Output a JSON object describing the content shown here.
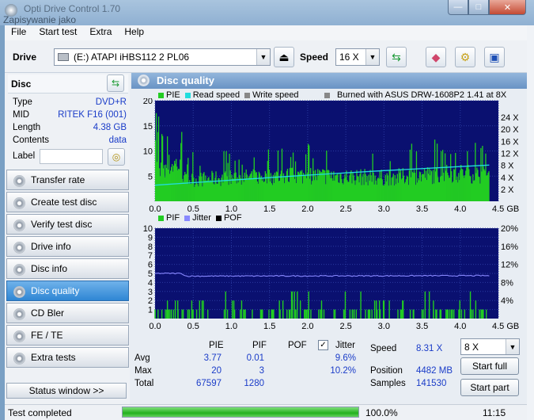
{
  "window": {
    "title": "Opti Drive Control 1.70",
    "subtitle": "Zapisywanie jako",
    "min": "—",
    "max": "□",
    "close": "✕"
  },
  "menu": [
    "File",
    "Start test",
    "Extra",
    "Help"
  ],
  "toolbar": {
    "drive_label": "Drive",
    "drive_value": "(E:)   ATAPI iHBS112   2 PL06",
    "speed_label": "Speed",
    "speed_value": "16 X"
  },
  "disc": {
    "header": "Disc",
    "rows": [
      {
        "k": "Type",
        "v": "DVD+R"
      },
      {
        "k": "MID",
        "v": "RITEK F16 (001)"
      },
      {
        "k": "Length",
        "v": "4.38 GB"
      },
      {
        "k": "Contents",
        "v": "data"
      }
    ],
    "label_key": "Label",
    "label_value": ""
  },
  "nav": [
    "Transfer rate",
    "Create test disc",
    "Verify test disc",
    "Drive info",
    "Disc info",
    "Disc quality",
    "CD Bler",
    "FE / TE",
    "Extra tests"
  ],
  "nav_active": 5,
  "status_window": "Status window >>",
  "panel": {
    "title": "Disc quality"
  },
  "legend_top": {
    "pie": "PIE",
    "read": "Read speed",
    "write": "Write speed",
    "burned": "Burned with ASUS DRW-1608P2 1.41 at 8X"
  },
  "legend_bottom": {
    "pif": "PIF",
    "jitter": "Jitter",
    "pof": "POF"
  },
  "colors": {
    "pie": "#22cc22",
    "read": "#22dddd",
    "write": "#888888",
    "pif": "#22cc22",
    "jitter": "#8888ff",
    "pof": "#000000",
    "plot_bg": "#0a1070",
    "accent": "#2f86d4"
  },
  "chart_data": [
    {
      "type": "bar",
      "x_ticks": [
        "0.0",
        "0.5",
        "1.0",
        "1.5",
        "2.0",
        "2.5",
        "3.0",
        "3.5",
        "4.0",
        "4.5 GB"
      ],
      "y_left_ticks": [
        "5",
        "10",
        "15",
        "20"
      ],
      "y_right_ticks": [
        "2 X",
        "4 X",
        "8 X",
        "12 X",
        "16 X",
        "20 X",
        "24 X"
      ],
      "xlim": [
        0,
        4.5
      ],
      "ylim": [
        0,
        20
      ],
      "series": [
        {
          "name": "PIE",
          "profile": [
            [
              0,
              14
            ],
            [
              0.3,
              16
            ],
            [
              0.4,
              9
            ],
            [
              1.0,
              10
            ],
            [
              2.0,
              11
            ],
            [
              3.0,
              10
            ],
            [
              4.0,
              12
            ],
            [
              4.38,
              11
            ]
          ]
        },
        {
          "name": "Read speed",
          "points": [
            [
              0,
              3.2
            ],
            [
              1.0,
              4.2
            ],
            [
              2.0,
              5.2
            ],
            [
              3.0,
              6.1
            ],
            [
              4.0,
              6.9
            ],
            [
              4.38,
              7.2
            ]
          ]
        }
      ]
    },
    {
      "type": "bar",
      "x_ticks": [
        "0.0",
        "0.5",
        "1.0",
        "1.5",
        "2.0",
        "2.5",
        "3.0",
        "3.5",
        "4.0",
        "4.5 GB"
      ],
      "y_left_ticks": [
        "1",
        "2",
        "3",
        "4",
        "5",
        "6",
        "7",
        "8",
        "9",
        "10"
      ],
      "y_right_ticks": [
        "4%",
        "8%",
        "12%",
        "16%",
        "20%"
      ],
      "xlim": [
        0,
        4.5
      ],
      "ylim": [
        0,
        10
      ],
      "series": [
        {
          "name": "PIF",
          "max": 3
        },
        {
          "name": "Jitter",
          "points": [
            [
              0,
              5.0
            ],
            [
              0.35,
              5.0
            ],
            [
              0.4,
              4.7
            ],
            [
              4.38,
              4.75
            ]
          ]
        }
      ]
    }
  ],
  "stats": {
    "cols": [
      "PIE",
      "PIF",
      "POF",
      "Jitter"
    ],
    "rows": [
      {
        "label": "Avg",
        "pie": "3.77",
        "pif": "0.01",
        "pof": "",
        "jitter": "9.6%"
      },
      {
        "label": "Max",
        "pie": "20",
        "pif": "3",
        "pof": "",
        "jitter": "10.2%"
      },
      {
        "label": "Total",
        "pie": "67597",
        "pif": "1280",
        "pof": "",
        "jitter": ""
      }
    ]
  },
  "info": {
    "speed_label": "Speed",
    "speed_value": "8.31 X",
    "position_label": "Position",
    "position_value": "4482 MB",
    "samples_label": "Samples",
    "samples_value": "141530",
    "select_speed": "8 X",
    "start_full": "Start full",
    "start_part": "Start part"
  },
  "statusbar": {
    "text": "Test completed",
    "progress": "100.0%",
    "progress_value": 100,
    "time": "11:15"
  }
}
